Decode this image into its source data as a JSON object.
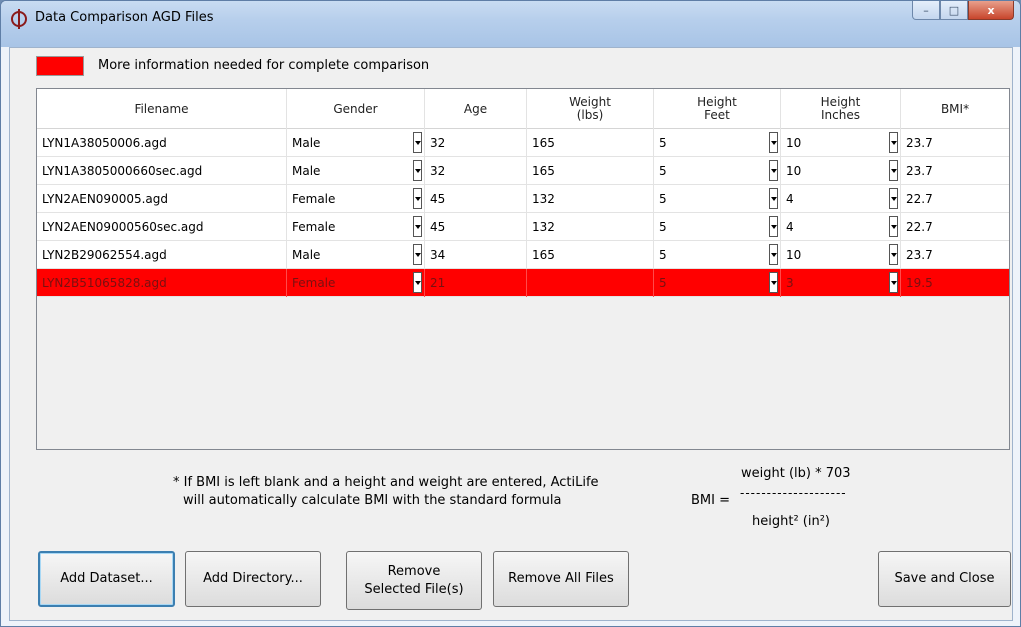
{
  "window": {
    "title": "Data Comparison AGD Files",
    "controls": {
      "minimize": "–",
      "maximize": "□",
      "close": "x"
    }
  },
  "legend": {
    "color": "#ff0000",
    "text": "More information needed for complete comparison"
  },
  "table": {
    "headers": [
      "Filename",
      "Gender",
      "Age",
      "Weight\n(lbs)",
      "Height\nFeet",
      "Height\nInches",
      "BMI*"
    ],
    "rows": [
      {
        "filename": "LYN1A38050006.agd",
        "gender": "Male",
        "age": "32",
        "weight": "165",
        "height_feet": "5",
        "height_inches": "10",
        "bmi": "23.7",
        "highlight": false
      },
      {
        "filename": "LYN1A3805000660sec.agd",
        "gender": "Male",
        "age": "32",
        "weight": "165",
        "height_feet": "5",
        "height_inches": "10",
        "bmi": "23.7",
        "highlight": false
      },
      {
        "filename": "LYN2AEN090005.agd",
        "gender": "Female",
        "age": "45",
        "weight": "132",
        "height_feet": "5",
        "height_inches": "4",
        "bmi": "22.7",
        "highlight": false
      },
      {
        "filename": "LYN2AEN09000560sec.agd",
        "gender": "Female",
        "age": "45",
        "weight": "132",
        "height_feet": "5",
        "height_inches": "4",
        "bmi": "22.7",
        "highlight": false
      },
      {
        "filename": "LYN2B29062554.agd",
        "gender": "Male",
        "age": "34",
        "weight": "165",
        "height_feet": "5",
        "height_inches": "10",
        "bmi": "23.7",
        "highlight": false
      },
      {
        "filename": "LYN2B51065828.agd",
        "gender": "Female",
        "age": "21",
        "weight": "",
        "height_feet": "5",
        "height_inches": "3",
        "bmi": "19.5",
        "highlight": true
      }
    ]
  },
  "note": {
    "line1": "* If BMI is left blank and a height and weight are entered, ActiLife",
    "line2": "will automatically calculate BMI with the standard formula"
  },
  "formula": {
    "label": "BMI =",
    "numerator": "weight (lb) * 703",
    "divider": "--------------------",
    "denominator": "height² (in²)"
  },
  "buttons": {
    "add_dataset": "Add Dataset...",
    "add_directory": "Add Directory...",
    "remove_selected_line1": "Remove",
    "remove_selected_line2": "Selected File(s)",
    "remove_all": "Remove All Files",
    "save_close": "Save and Close"
  }
}
